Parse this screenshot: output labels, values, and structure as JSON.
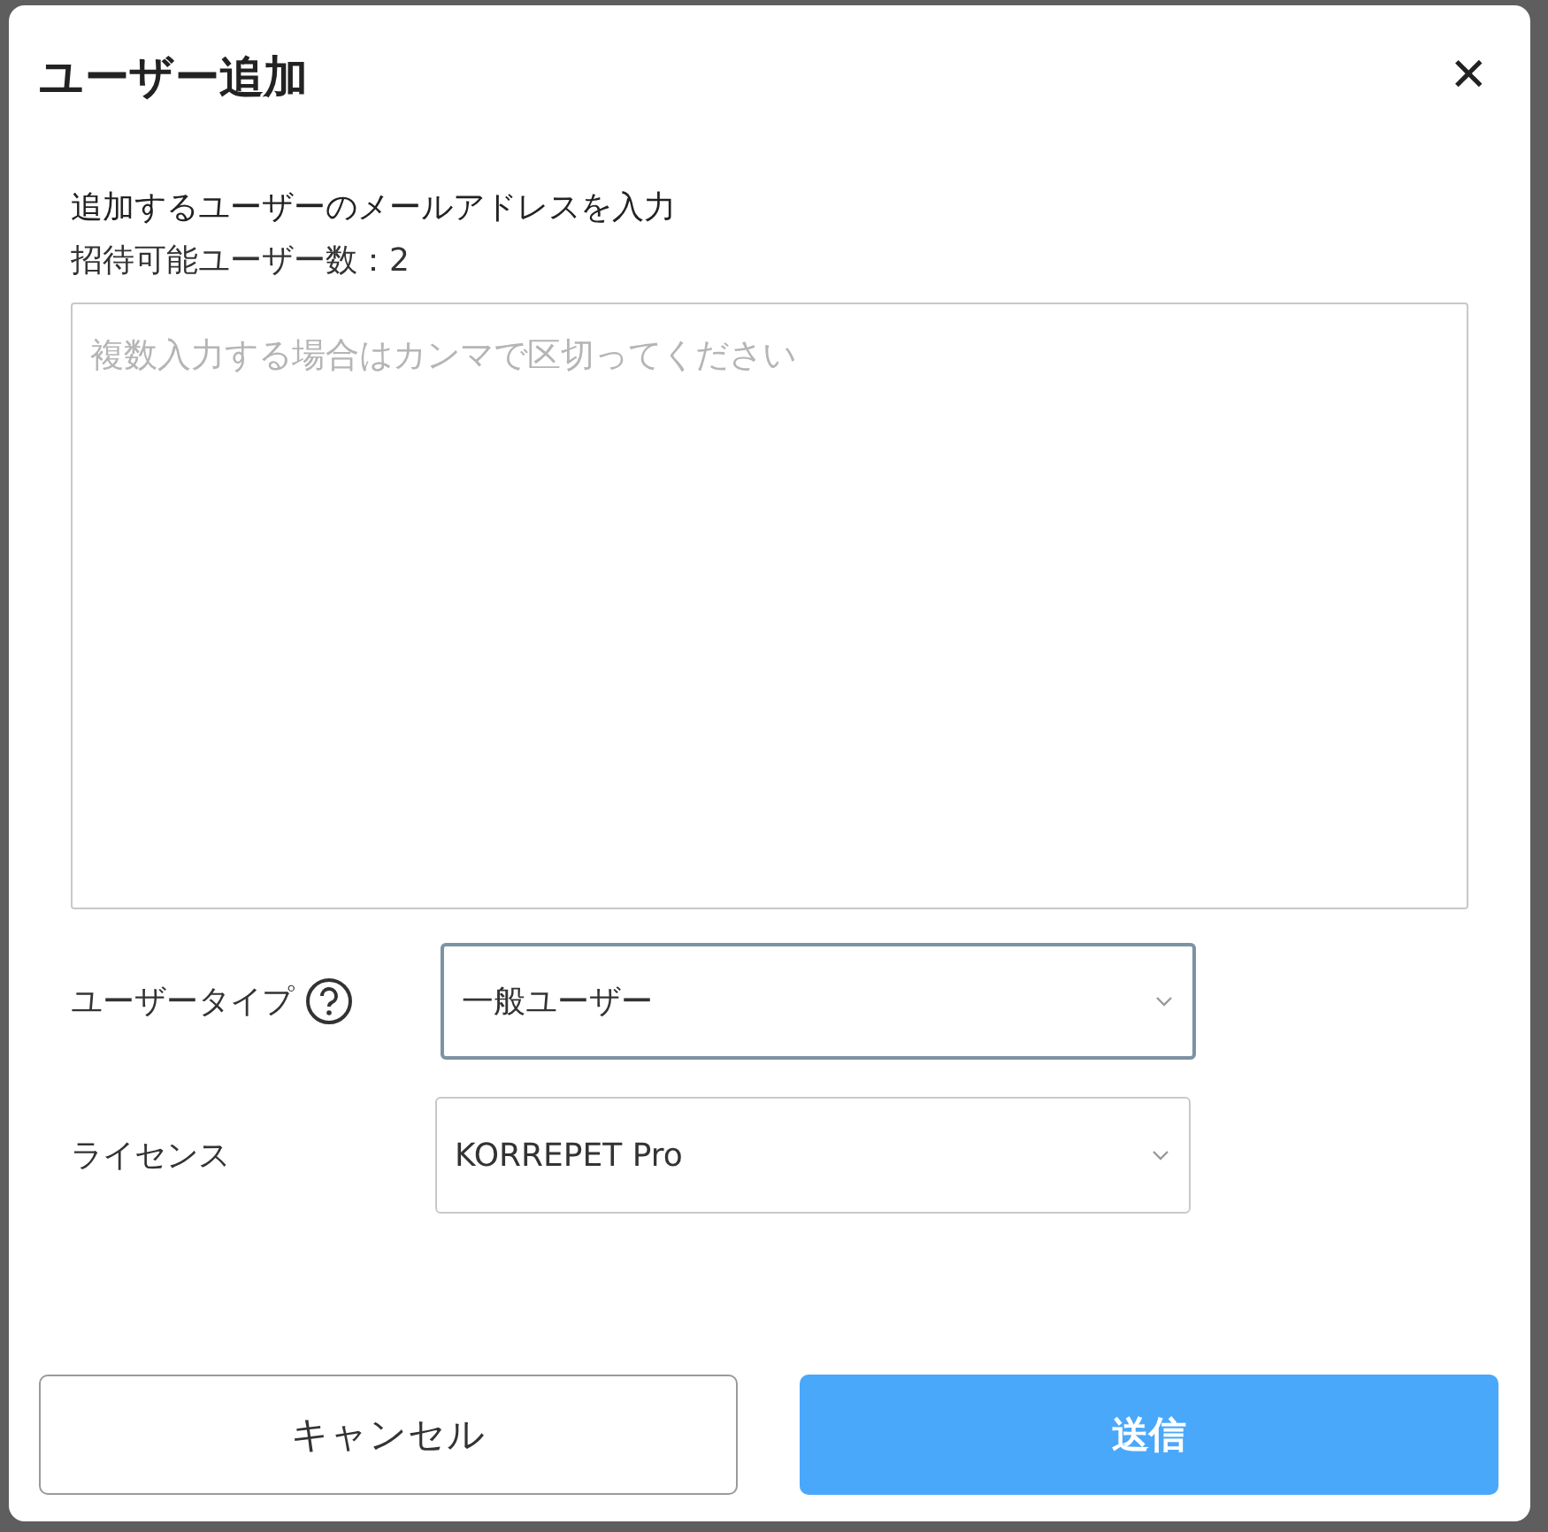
{
  "dialog": {
    "title": "ユーザー追加",
    "close": "✕",
    "instruction": "追加するユーザーのメールアドレスを入力",
    "invite_count": "招待可能ユーザー数：2",
    "email_field": {
      "placeholder": "複数入力する場合はカンマで区切ってください"
    },
    "fields": [
      {
        "label": "ユーザータイプ",
        "help": true,
        "value": "一般ユーザー",
        "focused": true
      },
      {
        "label": "ライセンス",
        "help": false,
        "value": "KORREPET Pro",
        "focused": false
      }
    ],
    "buttons": [
      {
        "label": "キャンセル",
        "kind": "secondary"
      },
      {
        "label": "送信",
        "kind": "primary"
      }
    ]
  }
}
